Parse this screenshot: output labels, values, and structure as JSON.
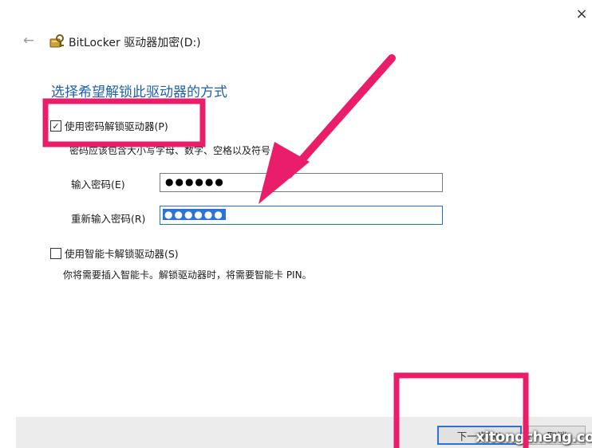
{
  "window": {
    "title": "BitLocker 驱动器加密(D:)",
    "close_icon": "×",
    "back_icon": "←"
  },
  "heading": "选择希望解锁此驱动器的方式",
  "password_option": {
    "label": "使用密码解锁驱动器(P)",
    "checked": true,
    "hint": "密码应该包含大小写字母、数字、空格以及符号",
    "password_label": "输入密码(E)",
    "password_value": "●●●●●●",
    "reenter_label": "重新输入密码(R)",
    "reenter_value": "●●●●●●"
  },
  "smartcard_option": {
    "label": "使用智能卡解锁驱动器(S)",
    "checked": false,
    "description": "你将需要插入智能卡。解锁驱动器时，将需要智能卡 PIN。"
  },
  "footer": {
    "next_button": "下一步(N)",
    "cancel_button": "取消"
  },
  "watermark": "xitongcheng.com",
  "colors": {
    "heading_blue": "#1f5fae",
    "focus_blue": "#1e6fd0",
    "annotation_pink": "#ea1d6a"
  },
  "icons": {
    "title": "bitlocker-key-icon",
    "back": "back-arrow-icon",
    "close": "close-icon"
  }
}
